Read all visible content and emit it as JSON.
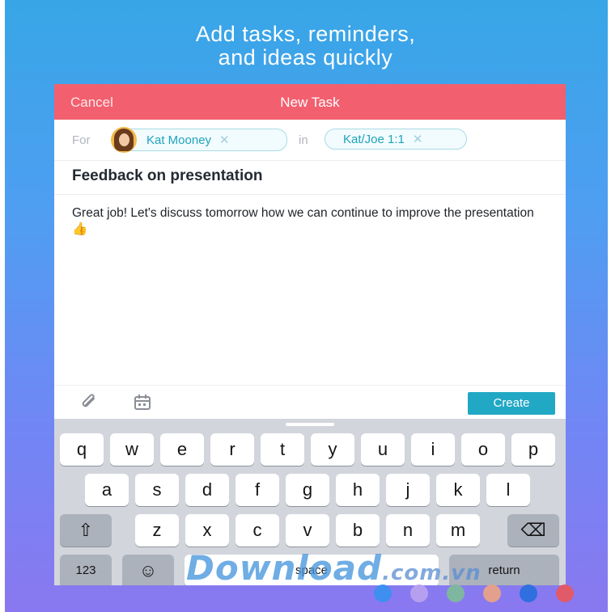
{
  "headline": {
    "line1": "Add tasks, reminders,",
    "line2": "and ideas quickly"
  },
  "header": {
    "cancel_label": "Cancel",
    "title": "New Task"
  },
  "assign": {
    "for_label": "For",
    "assignee_name": "Kat Mooney",
    "remove_glyph": "✕",
    "in_label": "in",
    "project_name": "Kat/Joe 1:1"
  },
  "task": {
    "name": "Feedback on presentation",
    "description": "Great job! Let's discuss tomorrow how we can continue to improve the presentation",
    "emoji": "👍"
  },
  "toolbar": {
    "attach_icon": "paperclip-icon",
    "calendar_icon": "calendar-icon",
    "create_label": "Create"
  },
  "keyboard": {
    "row1": [
      "q",
      "w",
      "e",
      "r",
      "t",
      "y",
      "u",
      "i",
      "o",
      "p"
    ],
    "row2": [
      "a",
      "s",
      "d",
      "f",
      "g",
      "h",
      "j",
      "k",
      "l"
    ],
    "row3": [
      "z",
      "x",
      "c",
      "v",
      "b",
      "n",
      "m"
    ],
    "shift_glyph": "⇧",
    "backspace_glyph": "⌫",
    "numbers_label": "123",
    "emoji_glyph": "☺",
    "space_label": "space",
    "return_label": "return"
  },
  "watermark": {
    "brand": "Download",
    "domain": ".com.vn"
  },
  "colors": {
    "header_bar": "#f25f6e",
    "accent": "#21a8c4",
    "dots": [
      "#3f8ff0",
      "#b5a0f0",
      "#7fb6a0",
      "#e3a08c",
      "#2f6fe0",
      "#e05a6a"
    ]
  }
}
